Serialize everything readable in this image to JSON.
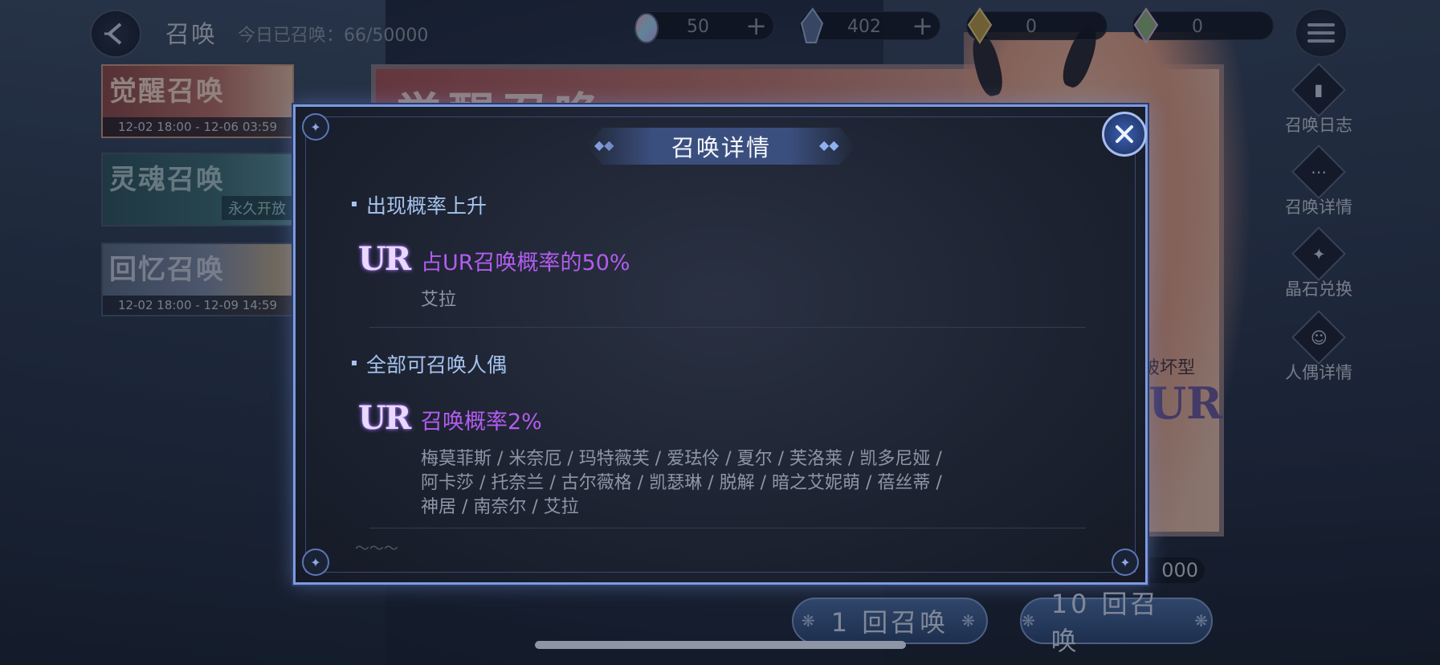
{
  "header": {
    "title": "召唤",
    "today_label": "今日已召唤：",
    "today_value": "66/50000"
  },
  "resources": [
    {
      "icon": "rainbow-gem-icon",
      "value": "50",
      "has_plus": true
    },
    {
      "icon": "crystal-icon",
      "value": "402",
      "has_plus": true
    },
    {
      "icon": "gold-crystal-icon",
      "value": "0",
      "has_plus": false
    },
    {
      "icon": "prism-crystal-icon",
      "value": "0",
      "has_plus": false
    }
  ],
  "side_menu": [
    {
      "icon": "log-icon",
      "label": "召唤日志"
    },
    {
      "icon": "more-icon",
      "label": "召唤详情"
    },
    {
      "icon": "star-crystal-icon",
      "label": "晶石兑换"
    },
    {
      "icon": "doll-search-icon",
      "label": "人偶详情"
    }
  ],
  "banners": [
    {
      "name": "觉醒召唤",
      "date": "12-02 18:00 - 12-06 03:59",
      "tag": ""
    },
    {
      "name": "灵魂召唤",
      "date": "",
      "tag": "永久开放"
    },
    {
      "name": "回忆召唤",
      "date": "12-02 18:00 - 12-09 14:59",
      "tag": ""
    }
  ],
  "card": {
    "big_title": "觉醒召唤",
    "type_label": "破坏型",
    "rarity": "UR",
    "cost": "000"
  },
  "pull_buttons": {
    "single": "1 回召唤",
    "ten": "10 回召唤"
  },
  "modal": {
    "title": "召唤详情",
    "section1": {
      "heading": "出现概率上升",
      "badge": "UR",
      "rate": "占UR召唤概率的50%",
      "names": "艾拉"
    },
    "section2": {
      "heading": "全部可召唤人偶",
      "badge": "UR",
      "rate": "召唤概率2%",
      "names_line1": "梅莫菲斯 / 米奈厄 / 玛特薇芙 / 爱珐伶 / 夏尔 / 芙洛莱 / 凯多尼娅 /",
      "names_line2": "阿卡莎 / 托奈兰 / 古尔薇格 / 凯瑟琳 / 脱解 / 暗之艾妮萌 / 蓓丝蒂 /",
      "names_line3": "神居 / 南奈尔 / 艾拉"
    }
  },
  "colors": {
    "accent": "#7c9be0",
    "rate_purple": "#b35cf0",
    "heading_blue": "#a6c3ee"
  }
}
